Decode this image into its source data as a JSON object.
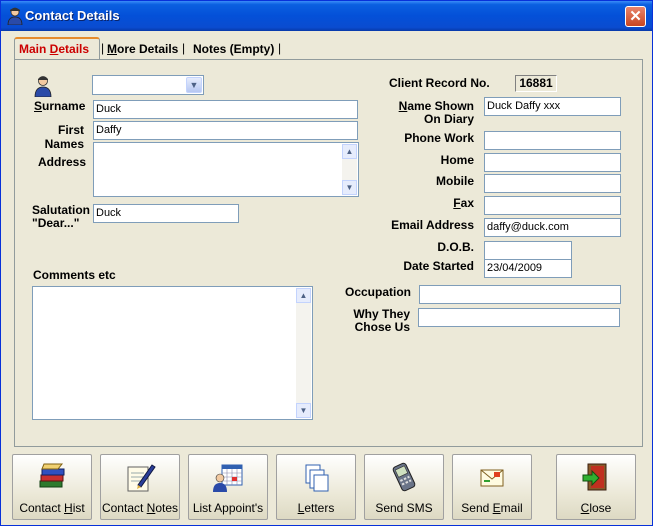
{
  "window": {
    "title": "Contact Details",
    "close_glyph": "✕"
  },
  "tabs": [
    {
      "pre": "Main ",
      "key": "D",
      "post": "etails"
    },
    {
      "pre": "",
      "key": "M",
      "post": "ore Details"
    },
    {
      "pre": "",
      "key": "",
      "post": "Notes (Empty)"
    }
  ],
  "tab_separator": "|",
  "form": {
    "salutation_select": "",
    "surname": {
      "label_key": "S",
      "label_rest": "urname",
      "value": "Duck"
    },
    "first_names": {
      "label1": "First",
      "label2": "Names",
      "value": "Daffy"
    },
    "address": {
      "label": "Address",
      "value": ""
    },
    "salutation": {
      "label1": "Salutation",
      "label2": "\"Dear...\"",
      "value": "Duck"
    },
    "comments": {
      "label": "Comments etc",
      "value": ""
    },
    "client_record_no": {
      "label": "Client Record No.",
      "value": "16881"
    },
    "name_on_diary": {
      "label_key": "N",
      "label_rest": "ame Shown",
      "label2": "On Diary",
      "value": "Duck Daffy xxx"
    },
    "phone_work": {
      "label": "Phone Work",
      "value": ""
    },
    "home": {
      "label": "Home",
      "value": ""
    },
    "mobile": {
      "label": "Mobile",
      "value": ""
    },
    "fax": {
      "label_key": "F",
      "label_rest": "ax",
      "value": ""
    },
    "email": {
      "label": "Email Address",
      "value": "daffy@duck.com"
    },
    "dob": {
      "label": "D.O.B.",
      "value": ""
    },
    "date_started": {
      "label": "Date Started",
      "value": "23/04/2009"
    },
    "occupation": {
      "label": "Occupation",
      "value": ""
    },
    "why_chose": {
      "label1": "Why They",
      "label2": "Chose Us",
      "value": ""
    }
  },
  "scroll": {
    "up": "▲",
    "down": "▼",
    "combo_arrow": "▼"
  },
  "toolbar": [
    {
      "icon": "books-icon",
      "pre": "Contact ",
      "key": "H",
      "post": "ist"
    },
    {
      "icon": "notes-pen-icon",
      "pre": "Contact ",
      "key": "N",
      "post": "otes"
    },
    {
      "icon": "calendar-person-icon",
      "pre": "List Appoint's",
      "key": "",
      "post": ""
    },
    {
      "icon": "letters-icon",
      "pre": "",
      "key": "L",
      "post": "etters"
    },
    {
      "icon": "phone-sms-icon",
      "pre": "Send SMS",
      "key": "",
      "post": ""
    },
    {
      "icon": "email-icon",
      "pre": "Send ",
      "key": "E",
      "post": "mail"
    },
    {
      "icon": "exit-door-icon",
      "pre": "",
      "key": "C",
      "post": "lose"
    }
  ]
}
